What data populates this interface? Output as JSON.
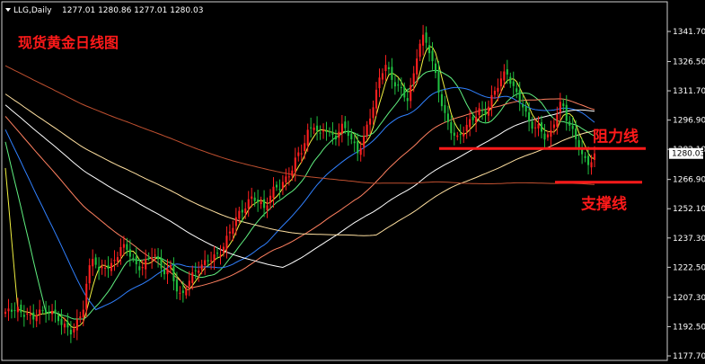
{
  "header": {
    "symbol_label": "LLG,Daily",
    "ohlc": "1277.01 1280.86 1277.01 1280.03"
  },
  "chart_data": {
    "type": "candlestick",
    "title": "现货黄金日线图",
    "yaxis": {
      "ticks": [
        1341.7,
        1326.5,
        1311.7,
        1296.9,
        1282.1,
        1266.9,
        1252.1,
        1237.3,
        1222.5,
        1207.3,
        1192.5,
        1177.7
      ],
      "ylim": [
        1177.7,
        1341.7
      ],
      "current_price": 1280.03
    },
    "annotations": {
      "resistance": {
        "label": "阻力线",
        "value": 1282.5
      },
      "support": {
        "label": "支撑线",
        "value": 1265.5
      }
    },
    "close_path": [
      1200,
      1199,
      1202,
      1197,
      1201,
      1196,
      1203,
      1198,
      1200,
      1197,
      1195,
      1193,
      1191,
      1195,
      1199,
      1218,
      1228,
      1220,
      1225,
      1223,
      1227,
      1232,
      1231,
      1227,
      1222,
      1225,
      1228,
      1230,
      1222,
      1219,
      1222,
      1213,
      1208,
      1215,
      1218,
      1221,
      1223,
      1227,
      1229,
      1231,
      1236,
      1241,
      1247,
      1250,
      1256,
      1259,
      1257,
      1252,
      1257,
      1262,
      1263,
      1268,
      1273,
      1280,
      1282,
      1290,
      1294,
      1288,
      1295,
      1290,
      1289,
      1293,
      1291,
      1285,
      1281,
      1288,
      1298,
      1306,
      1318,
      1324,
      1318,
      1315,
      1313,
      1308,
      1317,
      1333,
      1338,
      1332,
      1322,
      1309,
      1298,
      1291,
      1286,
      1290,
      1295,
      1299,
      1303,
      1300,
      1305,
      1311,
      1317,
      1322,
      1316,
      1310,
      1304,
      1295,
      1292,
      1293,
      1289,
      1291,
      1300,
      1306,
      1296,
      1290,
      1285,
      1278,
      1276,
      1280
    ],
    "moving_averages": [
      {
        "color": "#f0f040",
        "period": 5
      },
      {
        "color": "#60f080",
        "period": 14
      },
      {
        "color": "#3080ff",
        "period": 30
      },
      {
        "color": "#ff8060",
        "period": 60
      },
      {
        "color": "#ffffff",
        "period": 90
      },
      {
        "color": "#ffe0a0",
        "period": 120
      },
      {
        "color": "#c05030",
        "period": 200
      }
    ],
    "colors": {
      "up": "#ff2020",
      "down": "#20c040",
      "annotation": "#ff1a1a"
    }
  }
}
